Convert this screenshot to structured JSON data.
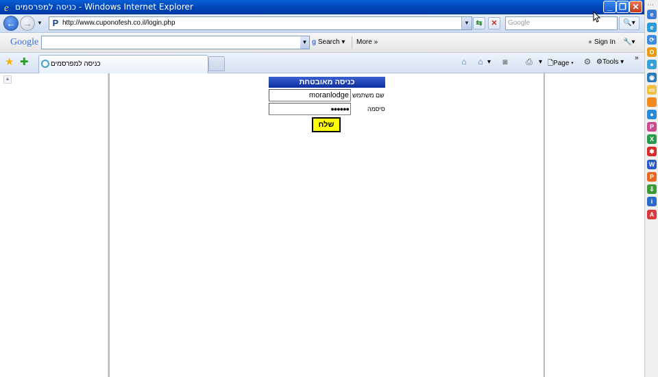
{
  "window": {
    "title": "כניסה למפרסמים - Windows Internet Explorer",
    "minimize": "_",
    "maximize": "❐",
    "close": "✕"
  },
  "address_bar": {
    "url": "http://www.cuponofesh.co.il/login.php",
    "search_placeholder": "Google"
  },
  "google_toolbar": {
    "logo": "Google",
    "search_label": "Search",
    "more_label": "More",
    "signin_label": "Sign In"
  },
  "tabs": [
    {
      "label": "כניסה למפרסמים"
    }
  ],
  "command_bar": {
    "page_label": "Page",
    "tools_label": "Tools"
  },
  "login_form": {
    "header": "כניסה מאובטחת",
    "username_label": "שם משתמש",
    "username_value": "moranlodge",
    "password_label": "סיסמה",
    "password_value": "●●●●●●",
    "submit_label": "שלח"
  }
}
